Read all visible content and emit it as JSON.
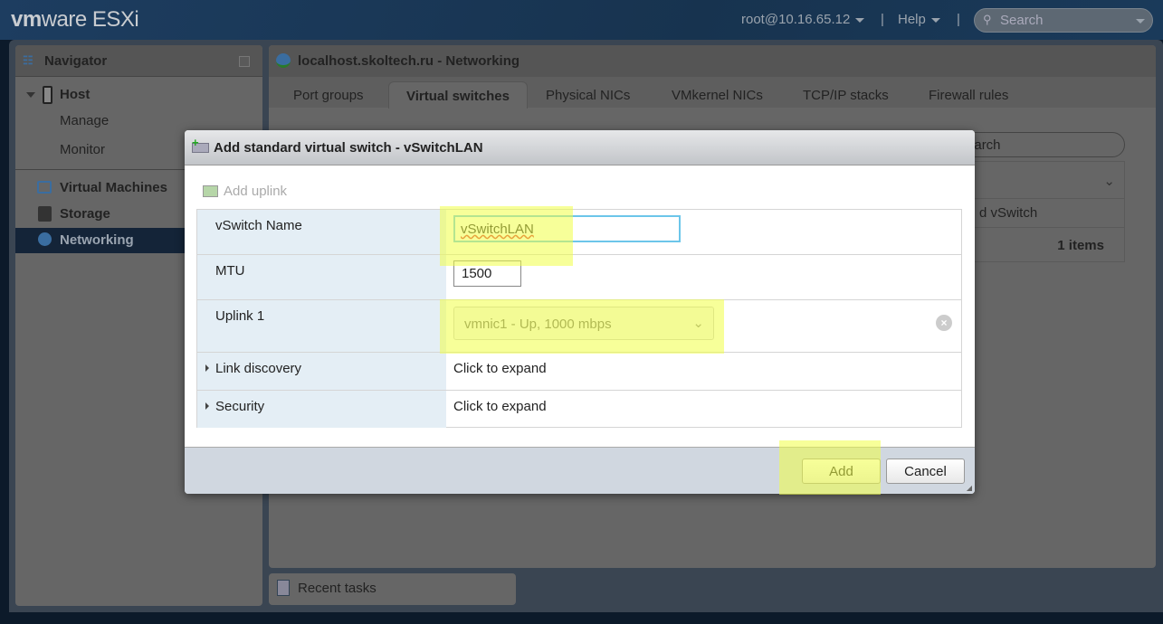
{
  "topbar": {
    "logo_vm": "vm",
    "logo_ware": "ware",
    "logo_product": "ESXi",
    "user": "root@10.16.65.12",
    "help": "Help",
    "search_placeholder": "Search"
  },
  "navigator": {
    "title": "Navigator",
    "items": [
      {
        "label": "Host"
      },
      {
        "label": "Manage"
      },
      {
        "label": "Monitor"
      },
      {
        "label": "Virtual Machines"
      },
      {
        "label": "Storage"
      },
      {
        "label": "Networking",
        "selected": true
      }
    ]
  },
  "main": {
    "title": "localhost.skoltech.ru - Networking",
    "tabs": [
      {
        "label": "Port groups"
      },
      {
        "label": "Virtual switches",
        "active": true
      },
      {
        "label": "Physical NICs"
      },
      {
        "label": "VMkernel NICs"
      },
      {
        "label": "TCP/IP stacks"
      },
      {
        "label": "Firewall rules"
      }
    ],
    "search_placeholder": "Search",
    "row_fragment": "d vSwitch",
    "items_count": "1 items"
  },
  "recent_tasks": "Recent tasks",
  "dialog": {
    "title": "Add standard virtual switch - vSwitchLAN",
    "add_uplink": "Add uplink",
    "fields": {
      "vswitch_name_label": "vSwitch Name",
      "vswitch_name_value": "vSwitchLAN",
      "mtu_label": "MTU",
      "mtu_value": "1500",
      "uplink_label": "Uplink 1",
      "uplink_value": "vmnic1 - Up, 1000 mbps",
      "link_discovery_label": "Link discovery",
      "link_discovery_value": "Click to expand",
      "security_label": "Security",
      "security_value": "Click to expand"
    },
    "add_button": "Add",
    "cancel_button": "Cancel"
  },
  "colors": {
    "highlight": "#f0ff46",
    "topbar": "#1d3d60",
    "selected_nav": "#142438"
  }
}
